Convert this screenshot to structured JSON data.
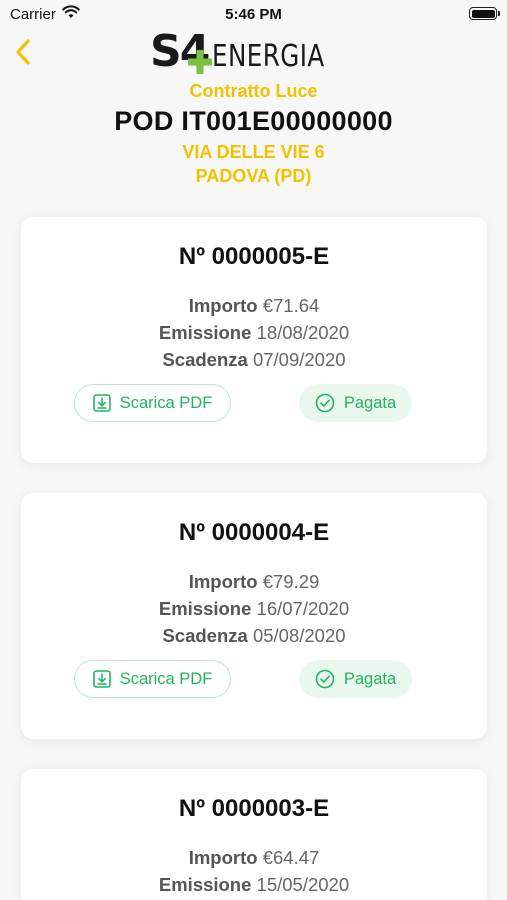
{
  "status_bar": {
    "carrier": "Carrier",
    "time": "5:46 PM"
  },
  "header": {
    "logo_s4": "S4",
    "logo_energia": "ENERGIA",
    "contract_type": "Contratto Luce",
    "pod": "POD IT001E00000000",
    "address_line_1": "VIA DELLE VIE 6",
    "address_line_2": "PADOVA (PD)"
  },
  "labels": {
    "importo": "Importo",
    "emissione": "Emissione",
    "scadenza": "Scadenza",
    "download_pdf": "Scarica PDF",
    "paid": "Pagata"
  },
  "colors": {
    "accent_yellow": "#f2c200",
    "paid_green": "#22b35e",
    "logo_green": "#7cc242"
  },
  "invoices": [
    {
      "number": "Nº 0000005-E",
      "amount": "€71.64",
      "issue_date": "18/08/2020",
      "due_date": "07/09/2020"
    },
    {
      "number": "Nº 0000004-E",
      "amount": "€79.29",
      "issue_date": "16/07/2020",
      "due_date": "05/08/2020"
    },
    {
      "number": "Nº 0000003-E",
      "amount": "€64.47",
      "issue_date": "15/05/2020",
      "due_date": ""
    }
  ],
  "icons": {
    "back": "chevron-left-icon",
    "wifi": "wifi-icon",
    "battery": "battery-icon",
    "download": "download-icon",
    "paid": "check-circle-icon"
  }
}
